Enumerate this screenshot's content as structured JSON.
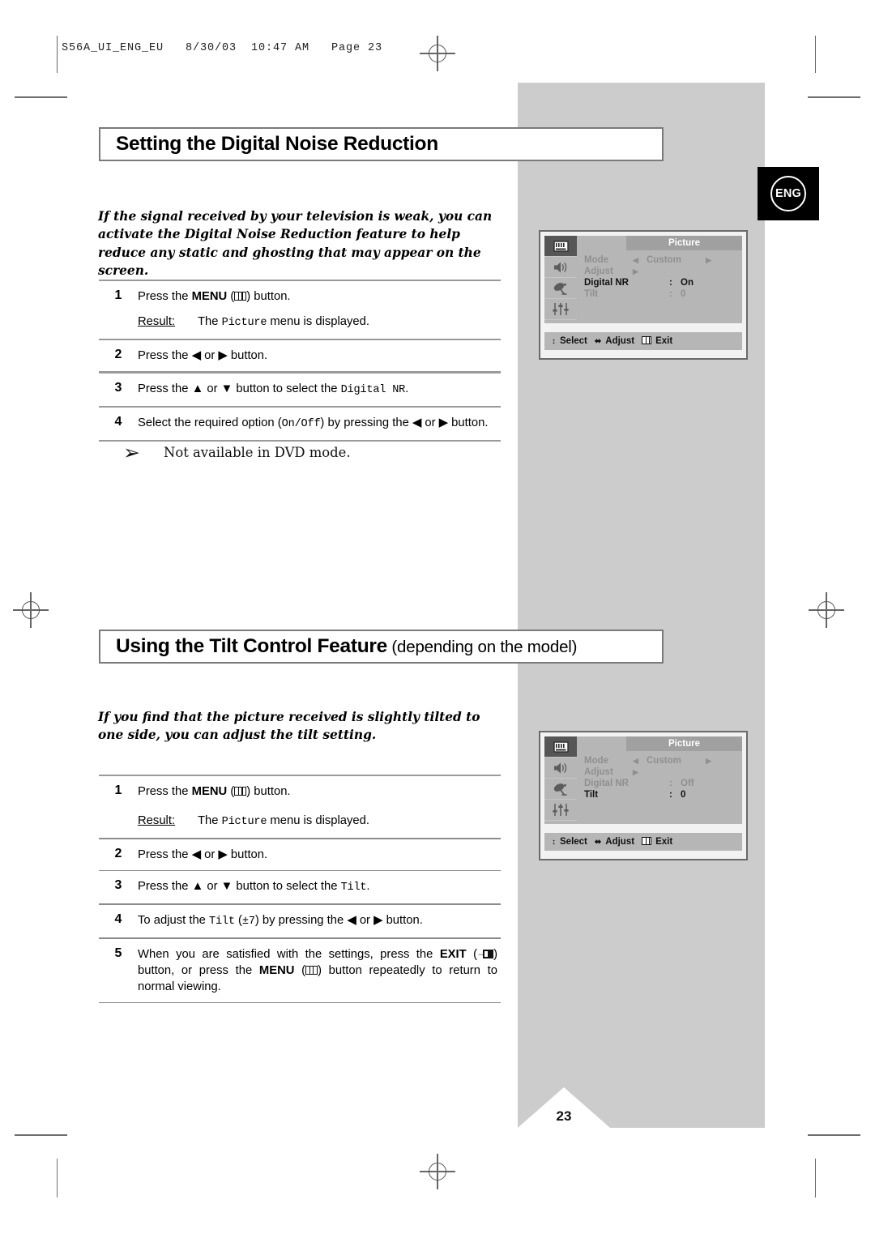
{
  "document": {
    "slug": "S56A_UI_ENG_EU   8/30/03  10:47 AM   Page 23",
    "page_number": "23",
    "language_badge": "ENG"
  },
  "sections": [
    {
      "heading": "Setting the Digital Noise Reduction",
      "heading_suffix": "",
      "intro": "If the signal received by your television is weak, you can activate the Digital Noise Reduction feature to help reduce any static and ghosting that may appear on the screen.",
      "steps": [
        {
          "num": "1",
          "text_a": "Press the ",
          "bold": "MENU",
          "text_b": " (",
          "icon": "menu-icon",
          "text_c": ") button.",
          "result_label": "Result:",
          "result_a": "The ",
          "result_mono": "Picture",
          "result_b": " menu is displayed."
        },
        {
          "num": "2",
          "text_a": "Press the ",
          "arrows": "◀ or ▶",
          "text_c": " button."
        },
        {
          "num": "3",
          "text_a": "Press the ",
          "arrows": "▲ or ▼",
          "text_c": " button to select the ",
          "mono": "Digital NR",
          "text_d": "."
        },
        {
          "num": "4",
          "text_a": "Select the required option (",
          "mono": "On/Off",
          "text_c": ") by pressing the ",
          "arrows": "◀ or ▶",
          "text_d": " button."
        }
      ],
      "note": {
        "arrow": "➢",
        "text": "Not available in DVD mode."
      },
      "osd": {
        "title": "Picture",
        "icons": [
          "picture-icon",
          "sound-icon",
          "channel-icon",
          "setup-icon",
          "blank-icon"
        ],
        "rows": [
          {
            "label": "Mode",
            "arrow_left": "◀",
            "option": "Custom",
            "arrow_right": "▶",
            "active": false
          },
          {
            "label": "Adjust",
            "arrow_left": "",
            "option": "▶",
            "arrow_right": "",
            "active": false
          },
          {
            "label": "Digital NR",
            "colon": ":",
            "value": "On",
            "active": true
          },
          {
            "label": "Tilt",
            "colon": ":",
            "value": "0",
            "active": false
          }
        ],
        "footer": [
          {
            "glyph": "↕",
            "label": "Select"
          },
          {
            "glyph": "⬌",
            "label": "Adjust"
          },
          {
            "glyph": "menu-icon",
            "label": "Exit"
          }
        ]
      }
    },
    {
      "heading": "Using the Tilt Control Feature",
      "heading_suffix": " (depending on the model)",
      "intro": "If you find that the picture received is slightly tilted to one side, you can adjust the tilt setting.",
      "steps": [
        {
          "num": "1",
          "text_a": "Press the ",
          "bold": "MENU",
          "text_b": " (",
          "icon": "menu-icon",
          "text_c": ") button.",
          "result_label": "Result:",
          "result_a": "The ",
          "result_mono": "Picture",
          "result_b": " menu is displayed."
        },
        {
          "num": "2",
          "text_a": "Press the ",
          "arrows": "◀ or ▶",
          "text_c": " button."
        },
        {
          "num": "3",
          "text_a": "Press the ",
          "arrows": "▲ or ▼",
          "text_c": " button to select the ",
          "mono": "Tilt",
          "text_d": "."
        },
        {
          "num": "4",
          "text_a": "To adjust the ",
          "mono": "Tilt",
          "text_c": " (",
          "mono2": "±7",
          "text_d": ") by pressing the ",
          "arrows": "◀ or ▶",
          "text_e": " button."
        },
        {
          "num": "5",
          "text_a": "When you are satisfied with the settings, press the ",
          "bold": "EXIT",
          "text_b": " (",
          "icon": "exit-icon",
          "text_c": ") button, or press the ",
          "bold2": "MENU",
          "text_d": " (",
          "icon2": "menu-icon",
          "text_e": ") button repeatedly to return to normal viewing."
        }
      ],
      "osd": {
        "title": "Picture",
        "icons": [
          "picture-icon",
          "sound-icon",
          "channel-icon",
          "setup-icon",
          "blank-icon"
        ],
        "rows": [
          {
            "label": "Mode",
            "arrow_left": "◀",
            "option": "Custom",
            "arrow_right": "▶",
            "active": false
          },
          {
            "label": "Adjust",
            "arrow_left": "",
            "option": "▶",
            "arrow_right": "",
            "active": false
          },
          {
            "label": "Digital NR",
            "colon": ":",
            "value": "Off",
            "active": false
          },
          {
            "label": "Tilt",
            "colon": ":",
            "value": "0",
            "active": true
          }
        ],
        "footer": [
          {
            "glyph": "↕",
            "label": "Select"
          },
          {
            "glyph": "⬌",
            "label": "Adjust"
          },
          {
            "glyph": "menu-icon",
            "label": "Exit"
          }
        ]
      }
    }
  ],
  "colors": {
    "panel_gray": "#cccccc",
    "osd_gray": "#b6b6b6",
    "osd_title_gray": "#a0a0a0",
    "osd_dim_text": "#8f8f8f",
    "badge_black": "#000000"
  }
}
